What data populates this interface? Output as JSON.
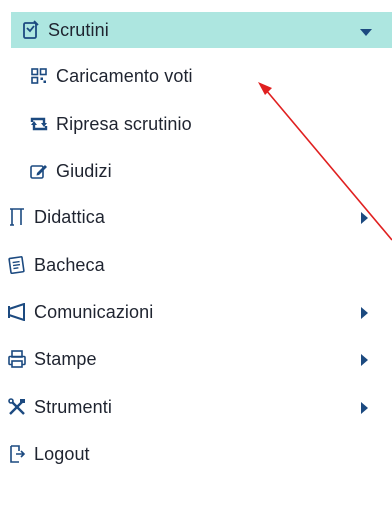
{
  "menu": {
    "items": [
      {
        "label": "Scrutini",
        "icon": "scrutini-icon",
        "expanded": true
      },
      {
        "label": "Caricamento voti",
        "icon": "grid-icon"
      },
      {
        "label": "Ripresa scrutinio",
        "icon": "retweet-icon"
      },
      {
        "label": "Giudizi",
        "icon": "edit-icon"
      },
      {
        "label": "Didattica",
        "icon": "didattica-icon",
        "has_submenu": true
      },
      {
        "label": "Bacheca",
        "icon": "bacheca-icon"
      },
      {
        "label": "Comunicazioni",
        "icon": "megaphone-icon",
        "has_submenu": true
      },
      {
        "label": "Stampe",
        "icon": "printer-icon",
        "has_submenu": true
      },
      {
        "label": "Strumenti",
        "icon": "tools-icon",
        "has_submenu": true
      },
      {
        "label": "Logout",
        "icon": "logout-icon"
      }
    ]
  },
  "colors": {
    "active_background": "#ade6e0",
    "icon_color": "#1c4a80",
    "text_color": "#1f2430",
    "annotation_arrow": "#e02020"
  }
}
